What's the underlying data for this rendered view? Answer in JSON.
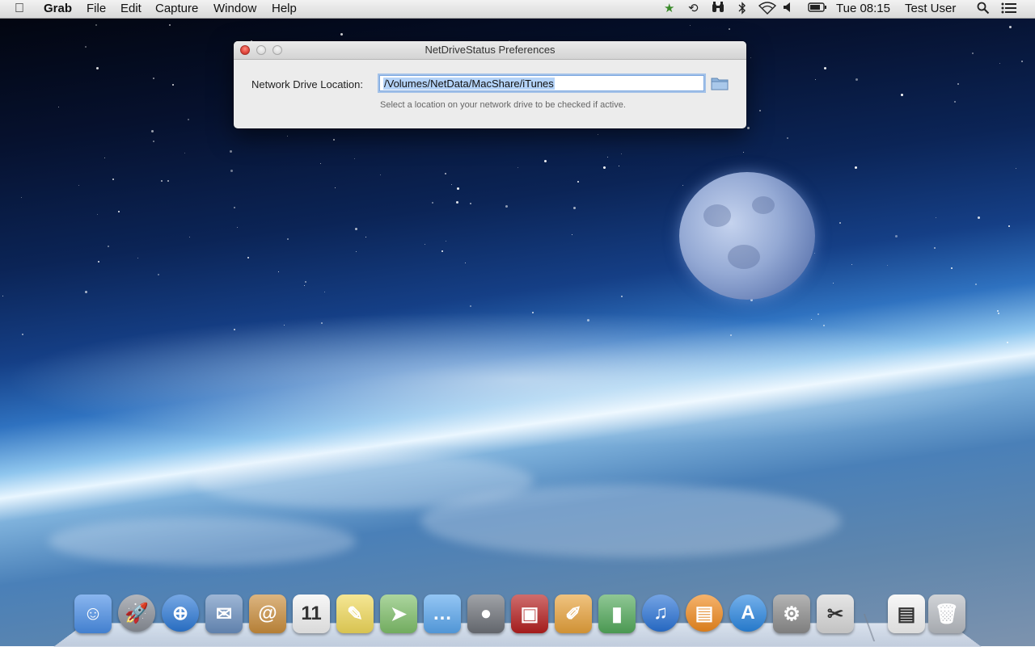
{
  "menubar": {
    "apple_icon": "apple-logo-icon",
    "app_name": "Grab",
    "menus": [
      "File",
      "Edit",
      "Capture",
      "Window",
      "Help"
    ],
    "status_icons": [
      "favorites-star-icon",
      "time-machine-icon",
      "binoculars-icon",
      "bluetooth-icon",
      "wifi-icon",
      "volume-icon",
      "battery-icon"
    ],
    "clock": "Tue 08:15",
    "user": "Test User",
    "spotlight_icon": "spotlight-search-icon",
    "notification_icon": "notification-center-icon"
  },
  "window": {
    "title": "NetDriveStatus Preferences",
    "location_label": "Network Drive Location:",
    "location_value": "/Volumes/NetData/MacShare/iTunes",
    "help_text": "Select a location on your network drive to be checked if active.",
    "folder_icon": "folder-icon"
  },
  "dock": {
    "items": [
      {
        "name": "finder-icon",
        "glyph": "☺",
        "bg": "#4a8ee6"
      },
      {
        "name": "launchpad-icon",
        "glyph": "🚀",
        "bg": "#8a8f98"
      },
      {
        "name": "safari-icon",
        "glyph": "⊕",
        "bg": "#2d79d6"
      },
      {
        "name": "mail-icon",
        "glyph": "✉",
        "bg": "#6a8fbf"
      },
      {
        "name": "contacts-icon",
        "glyph": "@",
        "bg": "#c98d3c"
      },
      {
        "name": "calendar-icon",
        "glyph": "11",
        "bg": "#f2f2f2"
      },
      {
        "name": "notes-icon",
        "glyph": "✎",
        "bg": "#f0d95a"
      },
      {
        "name": "maps-icon",
        "glyph": "➤",
        "bg": "#7fbf6a"
      },
      {
        "name": "messages-icon",
        "glyph": "…",
        "bg": "#5aa7ee"
      },
      {
        "name": "facetime-icon",
        "glyph": "●",
        "bg": "#6d7178"
      },
      {
        "name": "photo-booth-icon",
        "glyph": "▣",
        "bg": "#b51f1f"
      },
      {
        "name": "pages-icon",
        "glyph": "✐",
        "bg": "#e7a23b"
      },
      {
        "name": "numbers-icon",
        "glyph": "▮",
        "bg": "#53a95b"
      },
      {
        "name": "itunes-icon",
        "glyph": "♫",
        "bg": "#2a73d6"
      },
      {
        "name": "ibooks-icon",
        "glyph": "▤",
        "bg": "#f08a1e"
      },
      {
        "name": "app-store-icon",
        "glyph": "A",
        "bg": "#2a86e0"
      },
      {
        "name": "system-preferences-icon",
        "glyph": "⚙",
        "bg": "#8c8c8c"
      },
      {
        "name": "grab-icon",
        "glyph": "✂",
        "bg": "#d8d8d8"
      },
      {
        "name": "preview-document-icon",
        "glyph": "▤",
        "bg": "#f4f4f4"
      },
      {
        "name": "trash-icon",
        "glyph": "🗑",
        "bg": "#b8bcc2"
      }
    ]
  }
}
